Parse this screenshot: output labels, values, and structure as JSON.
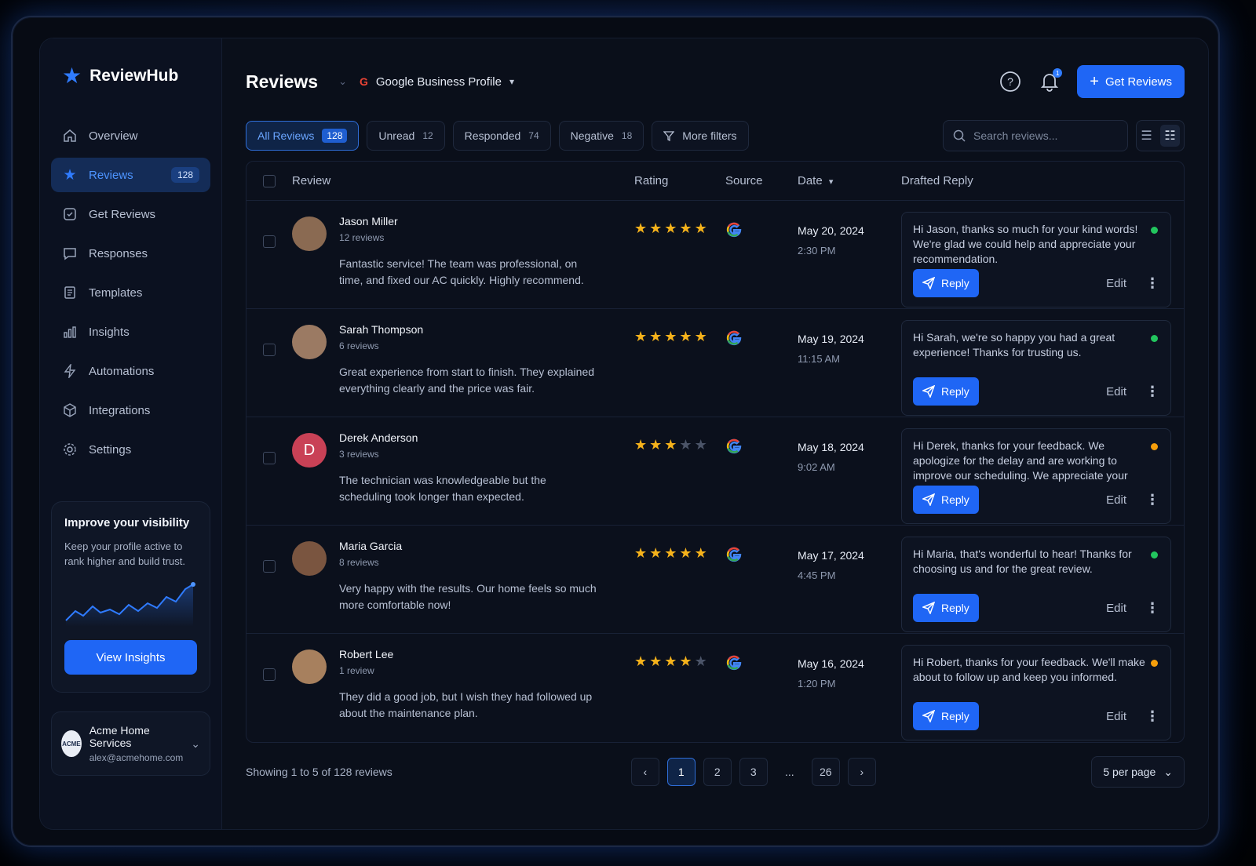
{
  "app": {
    "name": "ReviewHub"
  },
  "sidebar": {
    "items": [
      {
        "label": "Overview",
        "icon": "home-icon"
      },
      {
        "label": "Reviews",
        "icon": "star-icon",
        "badge": "128",
        "active": true
      },
      {
        "label": "Get Reviews",
        "icon": "get-reviews-icon"
      },
      {
        "label": "Responses",
        "icon": "chat-icon"
      },
      {
        "label": "Templates",
        "icon": "document-icon"
      },
      {
        "label": "Insights",
        "icon": "bar-chart-icon"
      },
      {
        "label": "Automations",
        "icon": "bolt-icon"
      },
      {
        "label": "Integrations",
        "icon": "cube-icon"
      },
      {
        "label": "Settings",
        "icon": "gear-icon"
      }
    ],
    "promo": {
      "title": "Improve your visibility",
      "text": "Keep your profile active to rank higher and build trust.",
      "button": "View Insights"
    },
    "account": {
      "name": "Acme Home Services",
      "email": "alex@acmehome.com"
    }
  },
  "header": {
    "title": "Reviews",
    "profile": "Google Business Profile",
    "notifications": "1",
    "primary_button": "Get Reviews"
  },
  "filters": {
    "chips": [
      {
        "label": "All Reviews",
        "count": "128",
        "active": true
      },
      {
        "label": "Unread",
        "count": "12"
      },
      {
        "label": "Responded",
        "count": "74"
      },
      {
        "label": "Negative",
        "count": "18"
      }
    ],
    "more": "More filters",
    "search_placeholder": "Search reviews..."
  },
  "table": {
    "columns": {
      "review": "Review",
      "rating": "Rating",
      "source": "Source",
      "date": "Date",
      "reply": "Drafted Reply"
    },
    "rows": [
      {
        "name": "Jason Miller",
        "count": "12 reviews",
        "text": "Fantastic service! The team was professional, on time, and fixed our AC quickly. Highly recommend.",
        "rating": 5,
        "date": "May 20, 2024",
        "time": "2:30 PM",
        "reply": "Hi Jason, thanks so much for your kind words! We're glad we could help and appreciate your recommendation.",
        "status_color": "#22c55e",
        "avatar_color": "#8a6a52",
        "avatar_initial": ""
      },
      {
        "name": "Sarah Thompson",
        "count": "6 reviews",
        "text": "Great experience from start to finish. They explained everything clearly and the price was fair.",
        "rating": 5,
        "date": "May 19, 2024",
        "time": "11:15 AM",
        "reply": "Hi Sarah, we're so happy you had a great experience! Thanks for trusting us.",
        "status_color": "#22c55e",
        "avatar_color": "#9b7a63",
        "avatar_initial": ""
      },
      {
        "name": "Derek Anderson",
        "count": "3 reviews",
        "text": "The technician was knowledgeable but the scheduling took longer than expected.",
        "rating": 3,
        "date": "May 18, 2024",
        "time": "9:02 AM",
        "reply": "Hi Derek, thanks for your feedback. We apologize for the delay and are working to improve our scheduling. We appreciate your patience.",
        "status_color": "#f59e0b",
        "avatar_color": "#c94156",
        "avatar_initial": "D"
      },
      {
        "name": "Maria Garcia",
        "count": "8 reviews",
        "text": "Very happy with the results. Our home feels so much more comfortable now!",
        "rating": 5,
        "date": "May 17, 2024",
        "time": "4:45 PM",
        "reply": "Hi Maria, that's wonderful to hear! Thanks for choosing us and for the great review.",
        "status_color": "#22c55e",
        "avatar_color": "#7a5540",
        "avatar_initial": ""
      },
      {
        "name": "Robert Lee",
        "count": "1 review",
        "text": "They did a good job, but I wish they had followed up about the maintenance plan.",
        "rating": 4,
        "date": "May 16, 2024",
        "time": "1:20 PM",
        "reply": "Hi Robert, thanks for your feedback. We'll make about to follow up and keep you informed.",
        "status_color": "#f59e0b",
        "avatar_color": "#a7805e",
        "avatar_initial": ""
      }
    ],
    "reply_label": "Reply",
    "edit_label": "Edit"
  },
  "footer": {
    "showing": "Showing 1 to 5 of 128 reviews",
    "pages": [
      "1",
      "2",
      "3",
      "...",
      "26"
    ],
    "current_page": "1",
    "per_page": "5 per page"
  },
  "colors": {
    "accent": "#1f66f5",
    "bg": "#0a0f1a",
    "star": "#f5b21b"
  }
}
